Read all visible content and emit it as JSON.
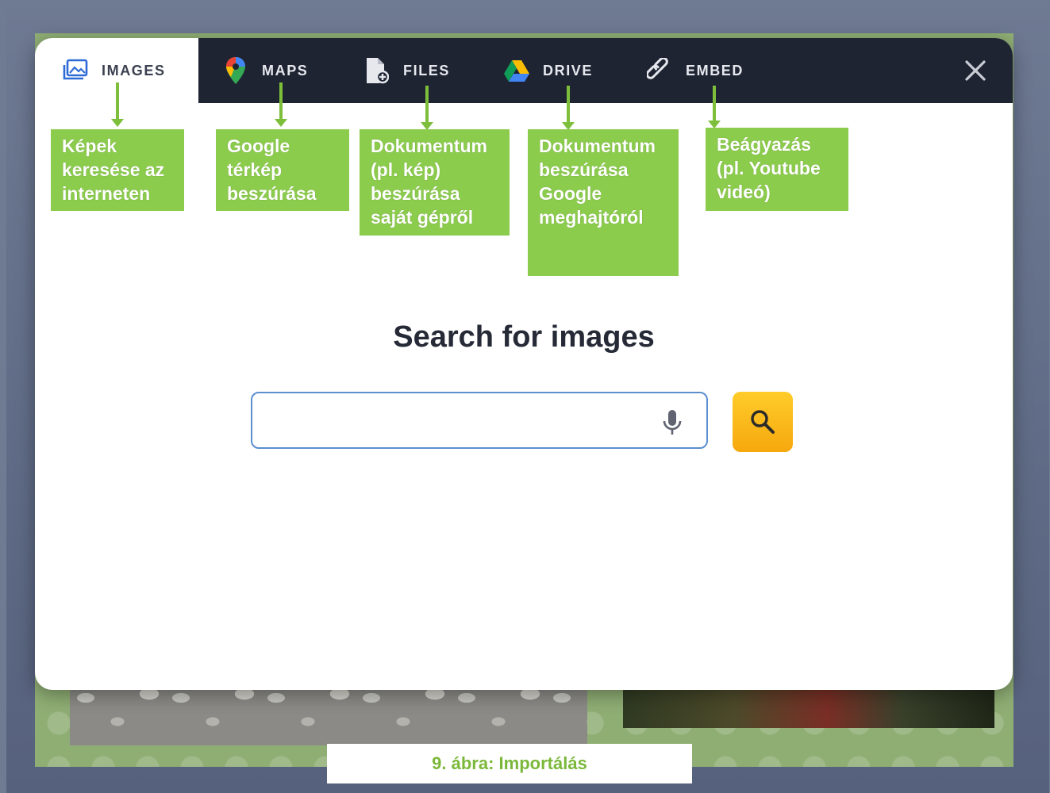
{
  "tabs": [
    {
      "label": "IMAGES",
      "icon": "images-icon"
    },
    {
      "label": "MAPS",
      "icon": "google-maps-icon"
    },
    {
      "label": "FILES",
      "icon": "file-add-icon"
    },
    {
      "label": "DRIVE",
      "icon": "google-drive-icon"
    },
    {
      "label": "EMBED",
      "icon": "link-icon"
    }
  ],
  "active_tab": "IMAGES",
  "close_icon": "close-icon",
  "main": {
    "title": "Search for images",
    "search": {
      "placeholder": "",
      "value": ""
    },
    "mic_icon": "microphone-icon",
    "search_button_icon": "search-icon"
  },
  "annotations": [
    "Képek\nkeresése az\ninterneten",
    "Google\ntérkép\nbeszúrása",
    "Dokumentum\n(pl. kép)\nbeszúrása\nsaját gépről",
    "Dokumentum\nbeszúrása\nGoogle\nmeghajtóról",
    "Beágyazás\n(pl. Youtube\nvideó)"
  ],
  "caption": "9. ábra: Importálás",
  "colors": {
    "tabbar": "#1f2433",
    "annotation": "#8ccc4d",
    "search_button": "#f9b81a",
    "search_border": "#5b8fce"
  }
}
